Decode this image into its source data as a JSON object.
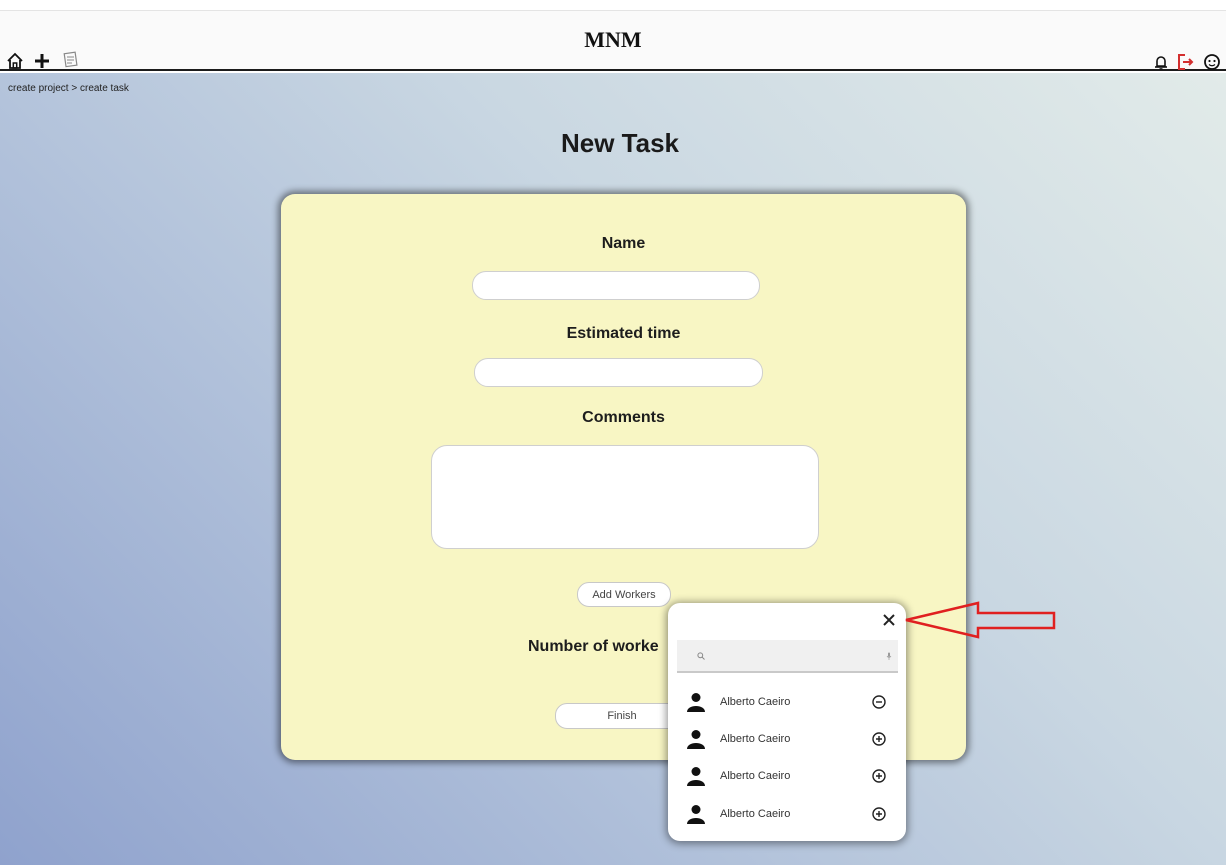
{
  "header": {
    "app_title": "MNM",
    "left_icons": [
      "home-icon",
      "plus-icon",
      "notes-icon"
    ],
    "right_icons": [
      "bell-icon",
      "logout-icon",
      "profile-icon"
    ],
    "logout_color": "#d32f2f"
  },
  "breadcrumb": "create project > create task",
  "page": {
    "title": "New Task"
  },
  "form": {
    "name_label": "Name",
    "name_value": "",
    "estimated_time_label": "Estimated time",
    "estimated_time_value": "",
    "comments_label": "Comments",
    "comments_value": "",
    "add_workers_label": "Add Workers",
    "workers_count_label": "Number of worke",
    "finish_label": "Finish",
    "card_color": "#f8f6c4"
  },
  "workers_popup": {
    "close_icon": "close-icon",
    "search_value": "",
    "workers": [
      {
        "name": "Alberto Caeiro",
        "action_icon": "minus-circle-icon"
      },
      {
        "name": "Alberto Caeiro",
        "action_icon": "plus-circle-icon"
      },
      {
        "name": "Alberto Caeiro",
        "action_icon": "plus-circle-icon"
      },
      {
        "name": "Alberto Caeiro",
        "action_icon": "plus-circle-icon"
      }
    ]
  },
  "annotation": {
    "arrow_color": "#e02020"
  }
}
